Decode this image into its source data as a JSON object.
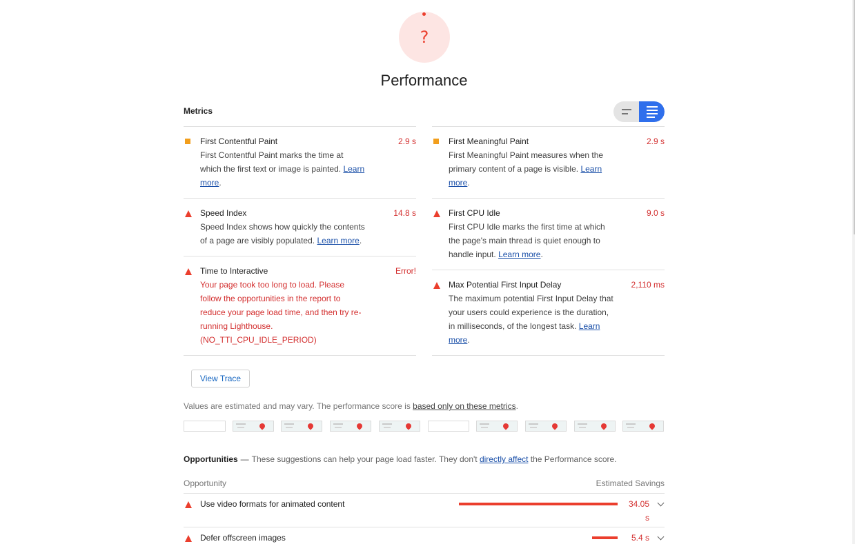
{
  "gauge": {
    "symbol": "?",
    "color": "#eb3e2d"
  },
  "category_title": "Performance",
  "metrics": {
    "header": "Metrics",
    "left": [
      {
        "marker": "average",
        "name": "First Contentful Paint",
        "value": "2.9 s",
        "desc": "First Contentful Paint marks the time at which the first text or image is painted.",
        "link": "Learn more",
        "after": "."
      },
      {
        "marker": "fail",
        "name": "Speed Index",
        "value": "14.8 s",
        "desc": "Speed Index shows how quickly the contents of a page are visibly populated.",
        "link": "Learn more",
        "after": "."
      },
      {
        "marker": "fail",
        "name": "Time to Interactive",
        "value": "Error!",
        "desc": "Your page took too long to load. Please follow the opportunities in the report to reduce your page load time, and then try re-running Lighthouse. (NO_TTI_CPU_IDLE_PERIOD)"
      }
    ],
    "right": [
      {
        "marker": "average",
        "name": "First Meaningful Paint",
        "value": "2.9 s",
        "desc": "First Meaningful Paint measures when the primary content of a page is visible.",
        "link": "Learn more",
        "after": "."
      },
      {
        "marker": "fail",
        "name": "First CPU Idle",
        "value": "9.0 s",
        "desc": "First CPU Idle marks the first time at which the page's main thread is quiet enough to handle input.",
        "link": "Learn more",
        "after": "."
      },
      {
        "marker": "fail",
        "name": "Max Potential First Input Delay",
        "value": "2,110 ms",
        "desc": "The maximum potential First Input Delay that your users could experience is the duration, in milliseconds, of the longest task.",
        "link": "Learn more",
        "after": "."
      }
    ]
  },
  "view_trace_label": "View Trace",
  "values_note": {
    "text": "Values are estimated and may vary. The performance score is ",
    "link": "based only on these metrics",
    "after": "."
  },
  "filmstrip": {
    "frames": [
      "blank",
      "map",
      "map",
      "map",
      "map",
      "blank",
      "map",
      "map",
      "map",
      "map"
    ]
  },
  "opportunities": {
    "title": "Opportunities",
    "dash": "—",
    "desc_before": "These suggestions can help your page load faster. They don't ",
    "desc_link": "directly affect",
    "desc_after": " the Performance score.",
    "col_opportunity": "Opportunity",
    "col_savings": "Estimated Savings",
    "rows": [
      {
        "name": "Use video formats for animated content",
        "saving_line1": "34.05",
        "saving_line2": "s",
        "bar_fraction": 1.0
      },
      {
        "name": "Defer offscreen images",
        "saving": "5.4 s",
        "bar_fraction": 0.16
      }
    ]
  }
}
